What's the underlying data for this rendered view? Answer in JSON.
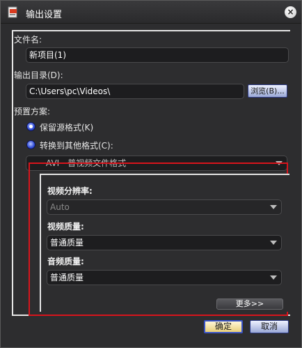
{
  "window": {
    "title": "输出设置",
    "close_glyph": "×"
  },
  "file_name": {
    "label": "文件名:",
    "value": "新项目(1)"
  },
  "output_dir": {
    "label": "输出目录(D):",
    "value": "C:\\Users\\pc\\Videos\\",
    "browse_label": "浏览(B)..."
  },
  "preset": {
    "label": "预置方案:",
    "options": [
      {
        "label": "保留源格式(K)",
        "checked": true
      },
      {
        "label": "转换到其他格式(C):",
        "checked": false
      }
    ],
    "format_value": "AVI - 普视频文件格式"
  },
  "video": {
    "resolution_label": "视频分辨率:",
    "resolution_value": "Auto",
    "quality_label": "视频质量:",
    "quality_value": "普通质量"
  },
  "audio": {
    "quality_label": "音频质量:",
    "quality_value": "普通质量"
  },
  "buttons": {
    "more": "更多>>",
    "ok": "确定",
    "cancel": "取消"
  },
  "colors": {
    "highlight_frame": "#d8141c",
    "radio_accent": "#2e4bd6",
    "background": "#2d2d2f"
  }
}
